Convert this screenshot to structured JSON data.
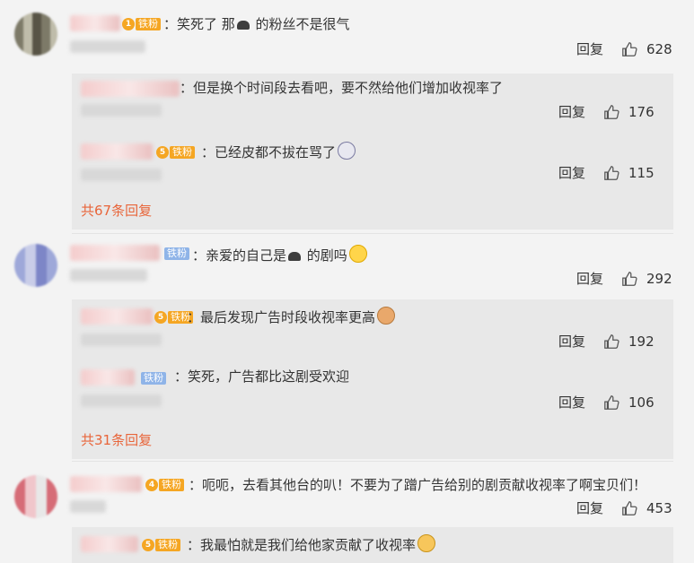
{
  "comments": [
    {
      "text": "：笑死了 那",
      "text_after_icon": " 的粉丝不是很气",
      "badge": "铁粉",
      "badge_level": "1",
      "reply_label": "回复",
      "likes": "628",
      "replies": [
        {
          "text": "：但是换个时间段去看吧，要不然给他们增加收视率了",
          "reply_label": "回复",
          "likes": "176"
        },
        {
          "text": "：已经皮都不拔在骂了",
          "badge": "铁粉",
          "badge_level": "5",
          "reply_label": "回复",
          "likes": "115"
        }
      ],
      "more_replies": "共67条回复"
    },
    {
      "text": "：亲爱的自己是",
      "text_after_icon": " 的剧吗",
      "badge": "铁粉",
      "reply_label": "回复",
      "likes": "292",
      "replies": [
        {
          "text": "：最后发现广告时段收视率更高",
          "badge": "铁粉",
          "badge_level": "5",
          "reply_label": "回复",
          "likes": "192"
        },
        {
          "text": "：笑死，广告都比这剧受欢迎",
          "badge": "铁粉",
          "reply_label": "回复",
          "likes": "106"
        }
      ],
      "more_replies": "共31条回复"
    },
    {
      "text": "：呃呃，去看其他台的叭！不要为了蹭广告给别的剧贡献收视率了啊宝贝们！",
      "badge": "铁粉",
      "badge_level": "4",
      "reply_label": "回复",
      "likes": "453",
      "replies": [
        {
          "text": "：我最怕就是我们给他家贡献了收视率",
          "badge": "铁粉",
          "badge_level": "5"
        }
      ]
    }
  ]
}
